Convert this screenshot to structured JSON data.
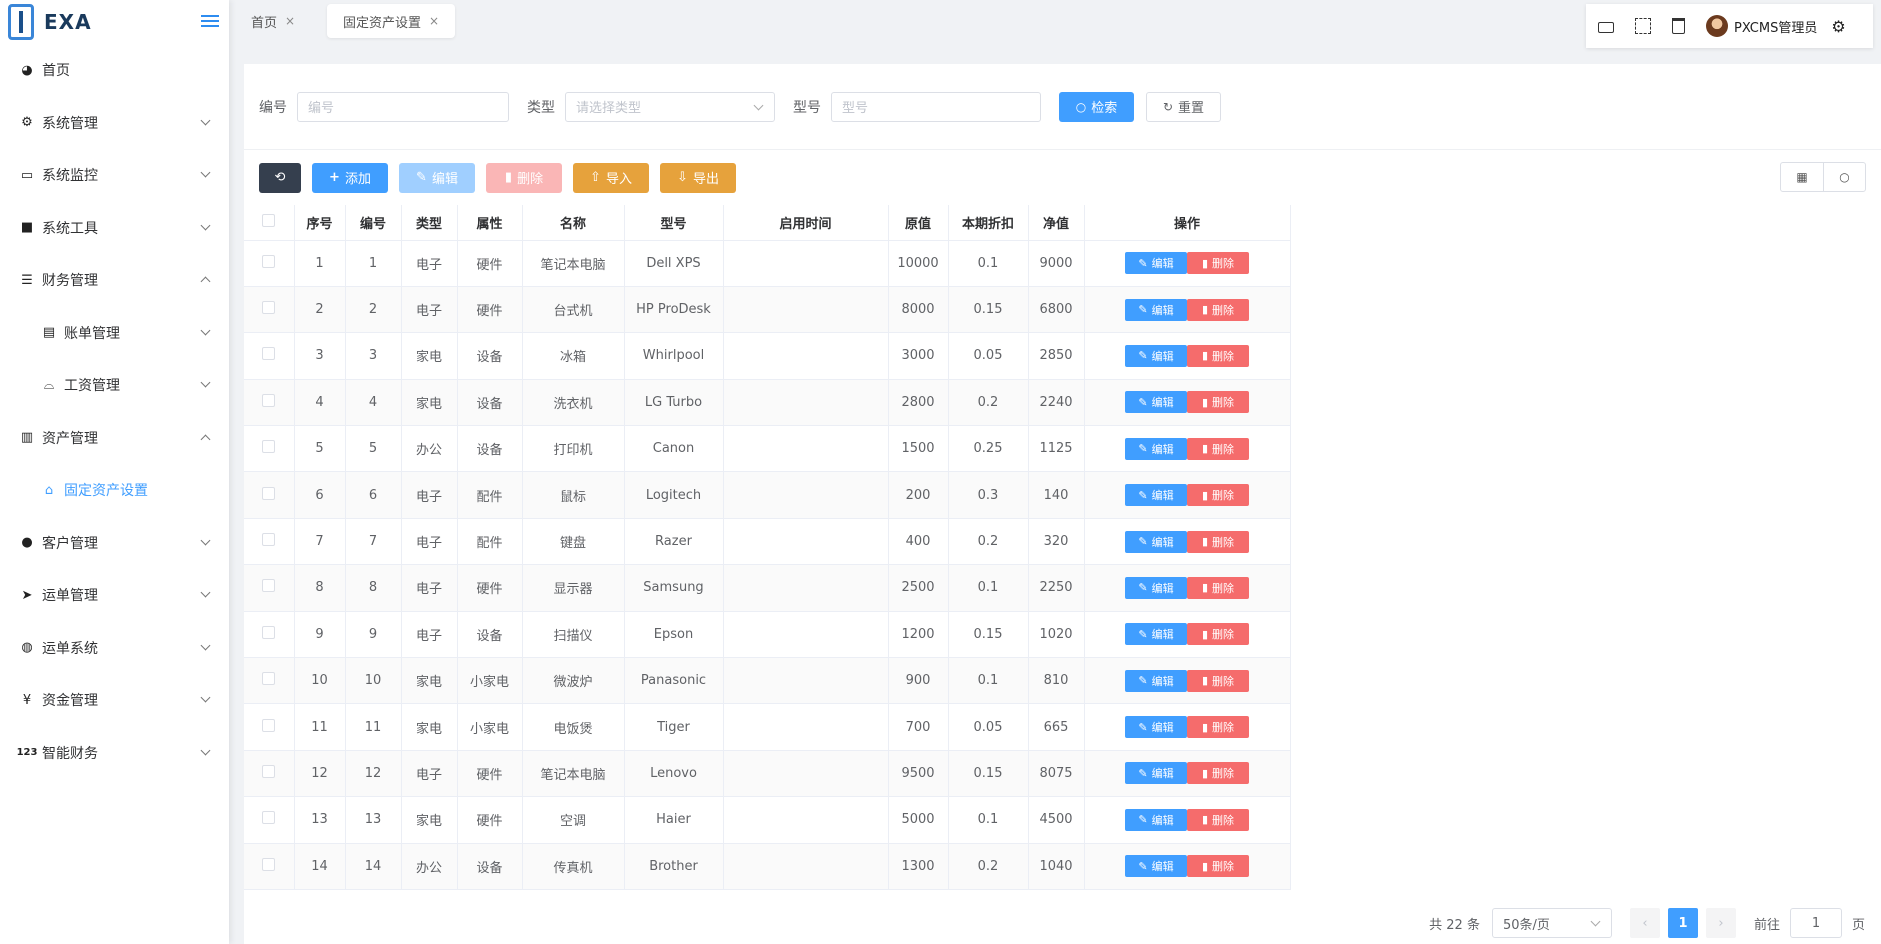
{
  "app": {
    "logo_text": "EXA"
  },
  "sidebar": {
    "items": [
      {
        "label": "首页",
        "icon": "dashboard-icon"
      },
      {
        "label": "系统管理",
        "icon": "gear-icon"
      },
      {
        "label": "系统监控",
        "icon": "monitor-icon"
      },
      {
        "label": "系统工具",
        "icon": "toolbox-icon"
      },
      {
        "label": "财务管理",
        "icon": "list-tree-icon"
      },
      {
        "label": "账单管理",
        "icon": "receipt-icon"
      },
      {
        "label": "工资管理",
        "icon": "cloche-icon"
      },
      {
        "label": "资产管理",
        "icon": "bar-chart-icon"
      },
      {
        "label": "固定资产设置",
        "icon": "home-icon"
      },
      {
        "label": "客户管理",
        "icon": "user-icon"
      },
      {
        "label": "运单管理",
        "icon": "paper-plane-icon"
      },
      {
        "label": "运单系统",
        "icon": "globe-icon"
      },
      {
        "label": "资金管理",
        "icon": "yen-icon"
      },
      {
        "label": "智能财务",
        "icon": "numbers-icon"
      }
    ]
  },
  "tabs": [
    {
      "label": "首页",
      "close": "×"
    },
    {
      "label": "固定资产设置",
      "close": "×"
    }
  ],
  "topbar": {
    "username": "PXCMS管理员"
  },
  "search": {
    "code_label": "编号",
    "code_placeholder": "编号",
    "type_label": "类型",
    "type_placeholder": "请选择类型",
    "model_label": "型号",
    "model_placeholder": "型号",
    "search_button": "检索",
    "reset_button": "重置"
  },
  "toolbar": {
    "add": "添加",
    "edit": "编辑",
    "delete": "删除",
    "import": "导入",
    "export": "导出"
  },
  "table": {
    "headers": [
      "序号",
      "编号",
      "类型",
      "属性",
      "名称",
      "型号",
      "启用时间",
      "原值",
      "本期折扣",
      "净值",
      "操作"
    ],
    "edit_label": "编辑",
    "delete_label": "删除",
    "rows": [
      [
        "1",
        "1",
        "电子",
        "硬件",
        "笔记本电脑",
        "Dell XPS",
        "",
        "10000",
        "0.1",
        "9000"
      ],
      [
        "2",
        "2",
        "电子",
        "硬件",
        "台式机",
        "HP ProDesk",
        "",
        "8000",
        "0.15",
        "6800"
      ],
      [
        "3",
        "3",
        "家电",
        "设备",
        "冰箱",
        "Whirlpool",
        "",
        "3000",
        "0.05",
        "2850"
      ],
      [
        "4",
        "4",
        "家电",
        "设备",
        "洗衣机",
        "LG Turbo",
        "",
        "2800",
        "0.2",
        "2240"
      ],
      [
        "5",
        "5",
        "办公",
        "设备",
        "打印机",
        "Canon",
        "",
        "1500",
        "0.25",
        "1125"
      ],
      [
        "6",
        "6",
        "电子",
        "配件",
        "鼠标",
        "Logitech",
        "",
        "200",
        "0.3",
        "140"
      ],
      [
        "7",
        "7",
        "电子",
        "配件",
        "键盘",
        "Razer",
        "",
        "400",
        "0.2",
        "320"
      ],
      [
        "8",
        "8",
        "电子",
        "硬件",
        "显示器",
        "Samsung",
        "",
        "2500",
        "0.1",
        "2250"
      ],
      [
        "9",
        "9",
        "电子",
        "设备",
        "扫描仪",
        "Epson",
        "",
        "1200",
        "0.15",
        "1020"
      ],
      [
        "10",
        "10",
        "家电",
        "小家电",
        "微波炉",
        "Panasonic",
        "",
        "900",
        "0.1",
        "810"
      ],
      [
        "11",
        "11",
        "家电",
        "小家电",
        "电饭煲",
        "Tiger",
        "",
        "700",
        "0.05",
        "665"
      ],
      [
        "12",
        "12",
        "电子",
        "硬件",
        "笔记本电脑",
        "Lenovo",
        "",
        "9500",
        "0.15",
        "8075"
      ],
      [
        "13",
        "13",
        "家电",
        "硬件",
        "空调",
        "Haier",
        "",
        "5000",
        "0.1",
        "4500"
      ],
      [
        "14",
        "14",
        "办公",
        "设备",
        "传真机",
        "Brother",
        "",
        "1300",
        "0.2",
        "1040"
      ]
    ]
  },
  "pagination": {
    "total": "共 22 条",
    "page_size": "50条/页",
    "current": "1",
    "goto_prefix": "前往",
    "goto_value": "1",
    "goto_suffix": "页"
  }
}
